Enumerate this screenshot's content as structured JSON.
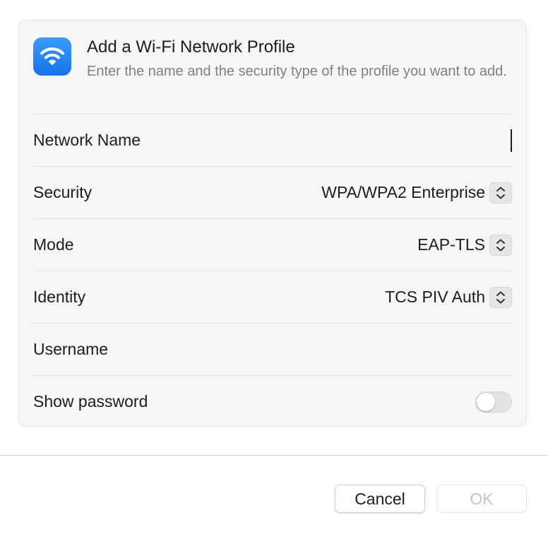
{
  "header": {
    "icon": "wifi-icon",
    "title": "Add a Wi-Fi Network Profile",
    "subtitle": "Enter the name and the security type of the profile you want to add."
  },
  "fields": {
    "network_name": {
      "label": "Network Name",
      "value": ""
    },
    "security": {
      "label": "Security",
      "value": "WPA/WPA2 Enterprise"
    },
    "mode": {
      "label": "Mode",
      "value": "EAP-TLS"
    },
    "identity": {
      "label": "Identity",
      "value": "TCS PIV Auth"
    },
    "username": {
      "label": "Username",
      "value": ""
    },
    "show_password": {
      "label": "Show password",
      "on": false
    }
  },
  "buttons": {
    "cancel": "Cancel",
    "ok": "OK"
  },
  "colors": {
    "accent": "#1a7bf2",
    "card_background": "#f6f6f6"
  }
}
